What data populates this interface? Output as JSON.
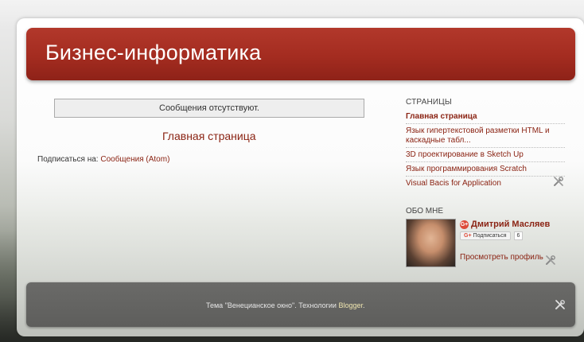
{
  "header": {
    "title": "Бизнес-информатика"
  },
  "main": {
    "notice": "Сообщения отсутствуют.",
    "home_link": "Главная страница",
    "subscribe_prefix": "Подписаться на:",
    "subscribe_link": "Сообщения (Atom)"
  },
  "sidebar": {
    "pages_title": "СТРАНИЦЫ",
    "pages": [
      {
        "label": "Главная страница"
      },
      {
        "label": "Язык гипертекстовой разметки HTML и каскадные табл..."
      },
      {
        "label": "3D проектирование в Sketch Up"
      },
      {
        "label": "Язык программирования Scratch"
      },
      {
        "label": "Visual Bacis for Application"
      }
    ],
    "about_title": "ОБО МНЕ",
    "profile_name": "Дмитрий Масляев",
    "follow_label": "Подписаться",
    "follow_count": "6",
    "view_profile": "Просмотреть профиль"
  },
  "footer": {
    "text": "Тема \"Венецианское окно\". Технологии",
    "brand": "Blogger",
    "end": "."
  },
  "icons": {
    "widget_edit": "wrench-screwdriver-icon",
    "gplus": "google-plus-icon"
  },
  "colors": {
    "header": "#a42c20",
    "link": "#8b2414",
    "footer": "#636361"
  }
}
